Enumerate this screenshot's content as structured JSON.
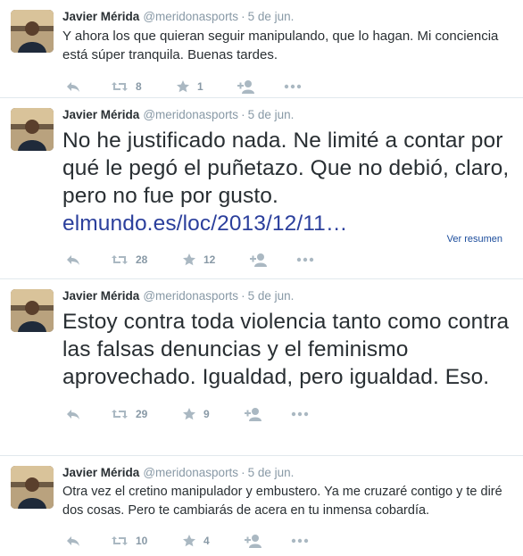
{
  "tweets": [
    {
      "name": "Javier Mérida",
      "handle": "@meridonasports",
      "date": "5 de jun.",
      "text": "Y ahora los que quieran seguir manipulando, que lo hagan. Mi conciencia está súper tranquila. Buenas tardes.",
      "retweets": "8",
      "favorites": "1"
    },
    {
      "name": "Javier Mérida",
      "handle": "@meridonasports",
      "date": "5 de jun.",
      "text": "No he justificado nada. Ne limité a contar por qué le pegó el puñetazo. Que no debió, claro, pero no fue por gusto.",
      "link": "elmundo.es/loc/2013/12/11…",
      "retweets": "28",
      "favorites": "12",
      "summary_link": "Ver resumen"
    },
    {
      "name": "Javier Mérida",
      "handle": "@meridonasports",
      "date": "5 de jun.",
      "text": "Estoy contra toda violencia tanto como contra las falsas denuncias y el feminismo aprovechado. Igualdad, pero igualdad. Eso.",
      "retweets": "29",
      "favorites": "9"
    },
    {
      "name": "Javier Mérida",
      "handle": "@meridonasports",
      "date": "5 de jun.",
      "text": "Otra vez el cretino manipulador y embustero. Ya me cruzaré contigo y te diré dos cosas. Pero te cambiarás de acera en tu inmensa cobardía.",
      "retweets": "10",
      "favorites": "4"
    }
  ],
  "icons": {
    "reply": "reply-icon",
    "retweet": "retweet-icon",
    "favorite": "star-icon",
    "follow": "add-user-icon",
    "more": "more-dots-icon"
  },
  "colors": {
    "text": "#292f33",
    "meta": "#8899a6",
    "icon": "#aab8c2",
    "link": "#2b3f9c",
    "divider": "#e1e8ed"
  }
}
